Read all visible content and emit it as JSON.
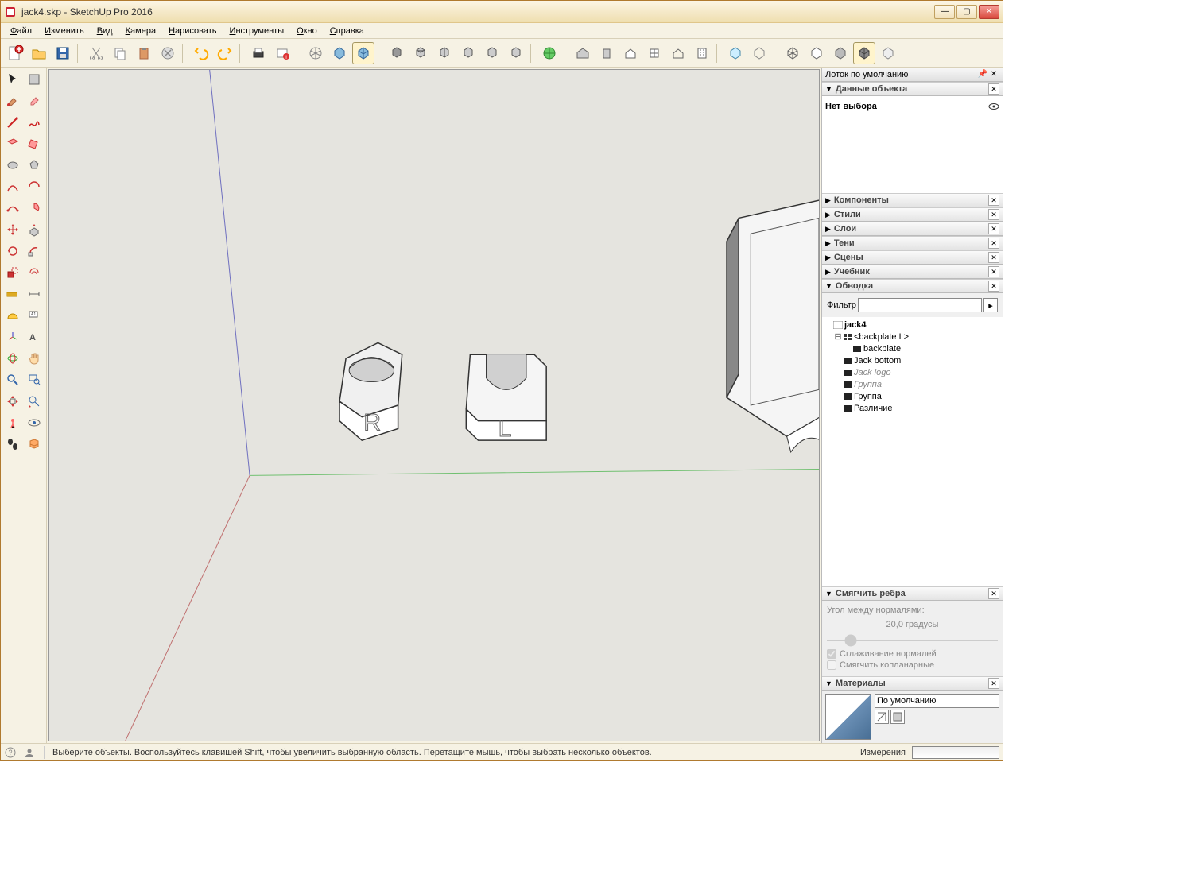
{
  "window": {
    "title": "jack4.skp - SketchUp Pro 2016"
  },
  "menu": {
    "file": "Файл",
    "edit": "Изменить",
    "view": "Вид",
    "camera": "Камера",
    "draw": "Нарисовать",
    "tools": "Инструменты",
    "window": "Окно",
    "help": "Справка"
  },
  "tray": {
    "title": "Лоток по умолчанию"
  },
  "panels": {
    "entity_info": "Данные объекта",
    "no_selection": "Нет выбора",
    "components": "Компоненты",
    "styles": "Стили",
    "layers": "Слои",
    "shadows": "Тени",
    "scenes": "Сцены",
    "instructor": "Учебник",
    "outliner": "Обводка",
    "soften": "Смягчить ребра",
    "materials": "Материалы"
  },
  "outliner": {
    "filter_label": "Фильтр",
    "root": "jack4",
    "items": [
      {
        "name": "<backplate L>",
        "type": "component",
        "expanded": true,
        "indent": 1,
        "children": [
          {
            "name": "backplate",
            "type": "group",
            "indent": 2
          }
        ]
      },
      {
        "name": "Jack bottom",
        "type": "group",
        "indent": 1
      },
      {
        "name": "Jack logo",
        "type": "group",
        "indent": 1,
        "italic": true
      },
      {
        "name": "Группа",
        "type": "group",
        "indent": 1,
        "italic": true
      },
      {
        "name": "Группа",
        "type": "group",
        "indent": 1
      },
      {
        "name": "Различие",
        "type": "group",
        "indent": 1
      }
    ]
  },
  "soften": {
    "angle_label": "Угол между нормалями:",
    "angle_value": "20,0  градусы",
    "smooth_normals": "Сглаживание нормалей",
    "soften_coplanar": "Смягчить копланарные"
  },
  "materials": {
    "default_name": "По умолчанию"
  },
  "statusbar": {
    "hint": "Выберите объекты. Воспользуйтесь клавишей Shift, чтобы увеличить выбранную область. Перетащите мышь, чтобы выбрать несколько объектов.",
    "measurements_label": "Измерения"
  }
}
